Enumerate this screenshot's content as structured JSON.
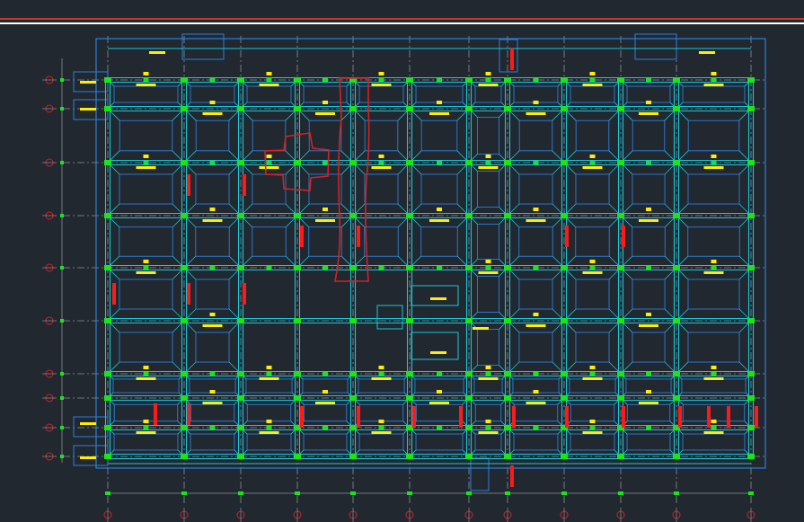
{
  "colors": {
    "background": "#212830",
    "beam": "#17c8d8",
    "outline": "#2d7fd8",
    "grid": "#8a9099",
    "column": "#19e619",
    "label": "#ffee00",
    "section": "#ff1a1a",
    "revision_cloud": "#d42222",
    "header_red": "#c0392b"
  },
  "drawing": {
    "type": "structural-foundation-plan",
    "grid_rows": 9,
    "grid_cols": 14
  }
}
